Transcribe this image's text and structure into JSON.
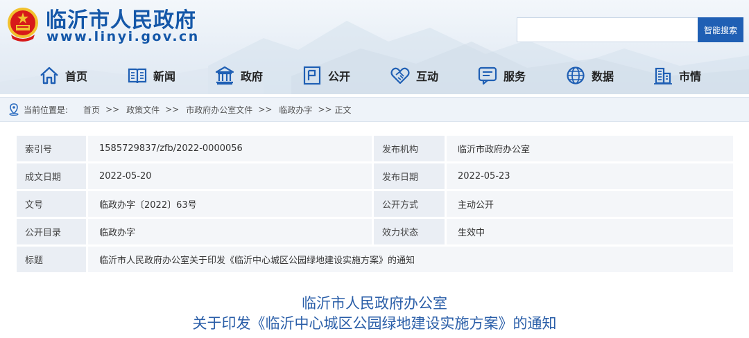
{
  "site": {
    "title": "临沂市人民政府",
    "url": "www.linyi.gov.cn"
  },
  "search": {
    "value": "",
    "placeholder": "",
    "button_label": "智能搜索"
  },
  "nav": {
    "items": [
      {
        "label": "首页",
        "icon": "home-icon"
      },
      {
        "label": "新闻",
        "icon": "newspaper-icon"
      },
      {
        "label": "政府",
        "icon": "government-building-icon"
      },
      {
        "label": "公开",
        "icon": "document-icon"
      },
      {
        "label": "互动",
        "icon": "handshake-icon"
      },
      {
        "label": "服务",
        "icon": "message-icon"
      },
      {
        "label": "数据",
        "icon": "globe-icon"
      },
      {
        "label": "市情",
        "icon": "city-building-icon"
      }
    ]
  },
  "breadcrumb": {
    "prefix": "当前位置是:",
    "separator": ">>",
    "items": [
      "首页",
      "政策文件",
      "市政府办公室文件",
      "临政办字",
      "正文"
    ]
  },
  "info": {
    "rows": [
      {
        "label1": "索引号",
        "value1": "1585729837/zfb/2022-0000056",
        "label2": "发布机构",
        "value2": "临沂市政府办公室"
      },
      {
        "label1": "成文日期",
        "value1": "2022-05-20",
        "label2": "发布日期",
        "value2": "2022-05-23"
      },
      {
        "label1": "文号",
        "value1": "临政办字〔2022〕63号",
        "label2": "公开方式",
        "value2": "主动公开"
      },
      {
        "label1": "公开目录",
        "value1": "临政办字",
        "label2": "效力状态",
        "value2": "生效中"
      }
    ],
    "title_label": "标题",
    "title_value": "临沂市人民政府办公室关于印发《临沂中心城区公园绿地建设实施方案》的通知"
  },
  "document": {
    "title_line1": "临沂市人民政府办公室",
    "title_line2": "关于印发《临沂中心城区公园绿地建设实施方案》的通知"
  },
  "colors": {
    "brand": "#1457a8",
    "search_button": "#1f5fb4",
    "doc_title": "#2a5ea8",
    "emblem_red": "#d7191a",
    "emblem_gold": "#f2c12e"
  }
}
